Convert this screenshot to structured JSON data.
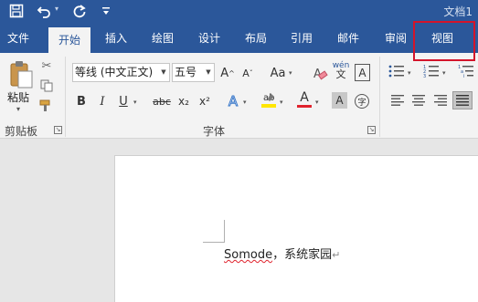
{
  "titlebar": {
    "doc_title": "文档1",
    "qat": [
      {
        "name": "save",
        "glyph": "🖫"
      },
      {
        "name": "undo",
        "glyph": "↶"
      },
      {
        "name": "redo",
        "glyph": "↻"
      },
      {
        "name": "customize",
        "glyph": "⩡"
      }
    ]
  },
  "tabs": [
    {
      "label": "文件"
    },
    {
      "label": "开始",
      "active": true
    },
    {
      "label": "插入"
    },
    {
      "label": "绘图"
    },
    {
      "label": "设计"
    },
    {
      "label": "布局"
    },
    {
      "label": "引用"
    },
    {
      "label": "邮件"
    },
    {
      "label": "审阅"
    },
    {
      "label": "视图"
    }
  ],
  "ribbon": {
    "clipboard": {
      "group_label": "剪贴板",
      "paste_label": "粘贴"
    },
    "font": {
      "group_label": "字体",
      "font_name": "等线 (中文正文)",
      "font_size": "五号",
      "bold": "B",
      "italic": "I",
      "underline": "U",
      "strikethrough": "abc",
      "subscript": "x₂",
      "superscript": "x²",
      "text_effects": "A",
      "font_color": "A",
      "char_shading": "A",
      "enclose": "字",
      "phonetic": "wén",
      "phonetic_sub": "文",
      "char_border": "A",
      "grow": "A",
      "shrink": "A",
      "change_case": "Aa",
      "clear": "A"
    }
  },
  "document": {
    "word_misspelled": "Somode",
    "text_rest": "，系统家园",
    "para_mark": "↵"
  },
  "colors": {
    "brand": "#2b579a",
    "highlight_box": "#d3142b",
    "highlight_yellow": "#ffe600",
    "font_red": "#e0232d"
  }
}
